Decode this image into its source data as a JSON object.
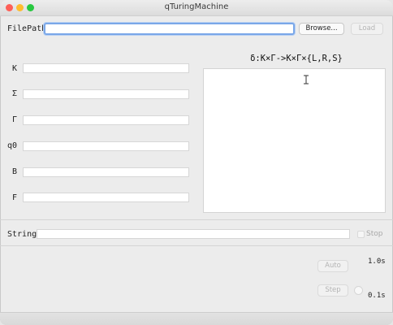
{
  "window": {
    "title": "qTuringMachine"
  },
  "filepath": {
    "label": "FilePath",
    "value": "",
    "browse_label": "Browse...",
    "load_label": "Load"
  },
  "fields": [
    {
      "label": "K",
      "value": ""
    },
    {
      "label": "Σ",
      "value": ""
    },
    {
      "label": "Γ",
      "value": ""
    },
    {
      "label": "q0",
      "value": ""
    },
    {
      "label": "B",
      "value": ""
    },
    {
      "label": "F",
      "value": ""
    }
  ],
  "delta": {
    "title": "δ:K×Γ->K×Γ×{L,R,S}",
    "value": ""
  },
  "string": {
    "label": "String",
    "value": "",
    "stop_label": "Stop"
  },
  "controls": {
    "auto_label": "Auto",
    "auto_time": "1.0s",
    "step_label": "Step",
    "step_time": "0.1s"
  }
}
